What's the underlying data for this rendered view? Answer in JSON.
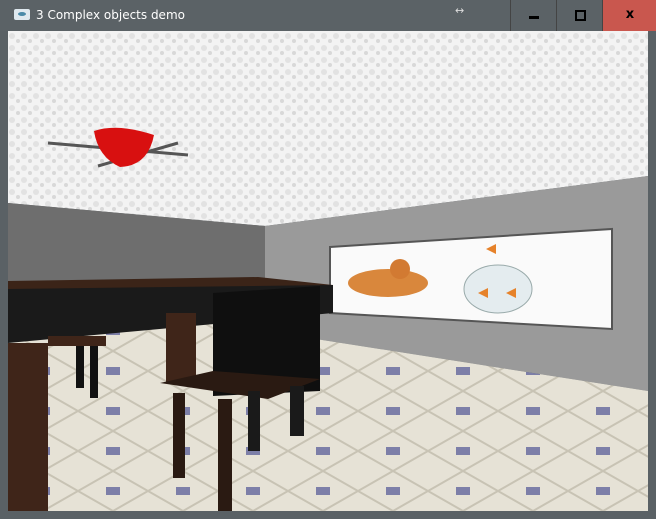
{
  "window": {
    "title": "3 Complex objects demo",
    "icon": "app-icon",
    "resize_icon": "↔"
  },
  "controls": {
    "minimize": "minimize-icon",
    "maximize": "maximize-icon",
    "close": "x"
  },
  "colors": {
    "titlebar": "#5b6266",
    "close": "#c9574e"
  }
}
